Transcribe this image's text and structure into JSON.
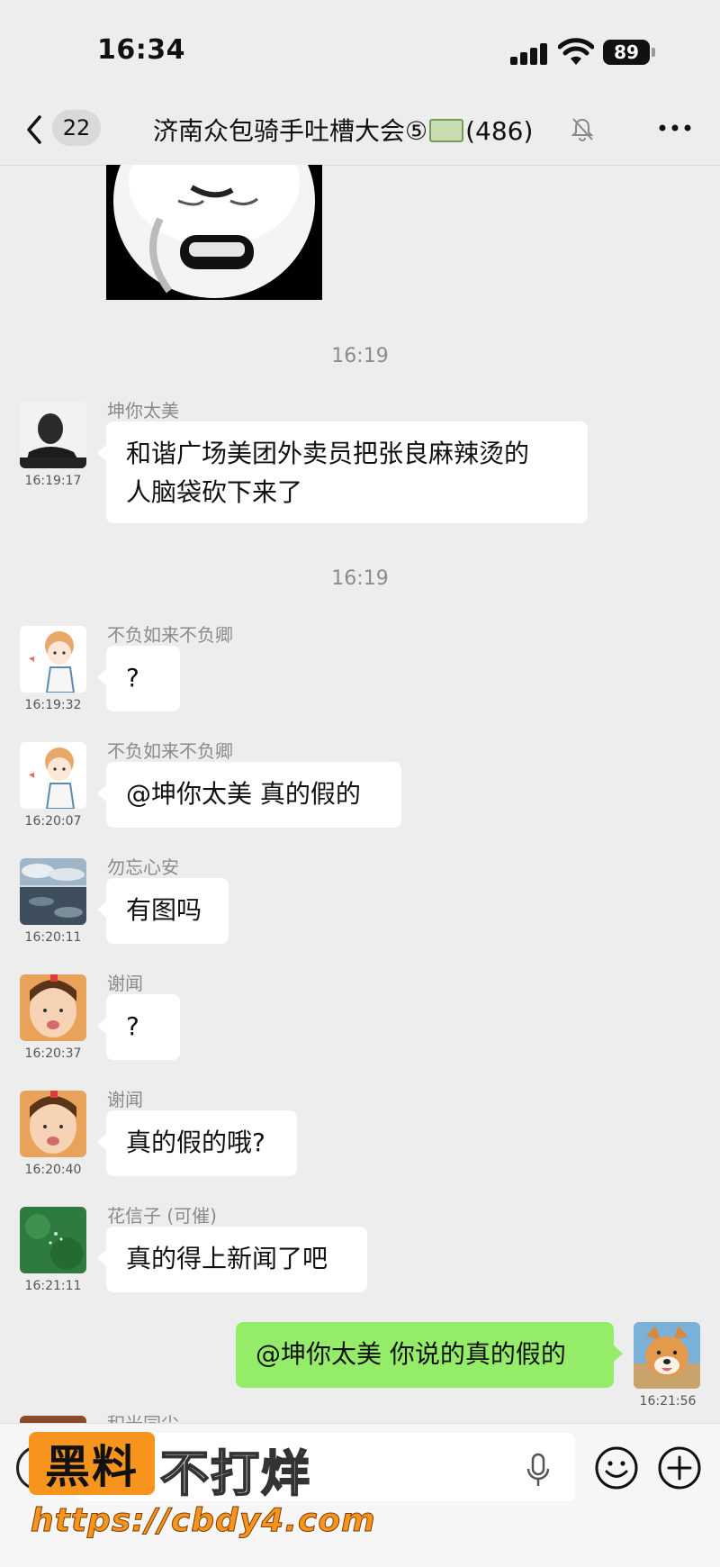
{
  "status_bar": {
    "time": "16:34",
    "battery": "89"
  },
  "nav": {
    "unread_count": "22",
    "title_prefix": "济南众包骑手吐槽大会⑤",
    "title_suffix": "(486)"
  },
  "timestamps": [
    "16:19",
    "16:19"
  ],
  "messages": [
    {
      "sender": "坤你太美",
      "time": "16:19:17",
      "text_line1": "和谐广场美团外卖员把张良麻辣烫的",
      "text_line2": "人脑袋砍下来了"
    },
    {
      "sender": "不负如来不负卿",
      "time": "16:19:32",
      "text": "?"
    },
    {
      "sender": "不负如来不负卿",
      "time": "16:20:07",
      "text": "@坤你太美 真的假的"
    },
    {
      "sender": "勿忘心安",
      "time": "16:20:11",
      "text": "有图吗"
    },
    {
      "sender": "谢闻",
      "time": "16:20:37",
      "text": "?"
    },
    {
      "sender": "谢闻",
      "time": "16:20:40",
      "text": "真的假的哦?"
    },
    {
      "sender": "花信子 (可催)",
      "time": "16:21:11",
      "text": "真的得上新闻了吧"
    },
    {
      "sender": "",
      "time": "16:21:56",
      "text": "@坤你太美 你说的真的假的"
    }
  ],
  "partial_sender": "积光同尘",
  "watermark": {
    "badge": "黑料",
    "text": "不打烊",
    "url": "https://cbdy4.com"
  },
  "colors": {
    "background": "#ededed",
    "bubble_other": "#ffffff",
    "bubble_self": "#95ec69",
    "watermark_orange": "#f7941d"
  },
  "icons": [
    "back-icon",
    "mute-icon",
    "more-icon",
    "voice-icon",
    "mic-icon",
    "emoji-icon",
    "plus-icon"
  ]
}
